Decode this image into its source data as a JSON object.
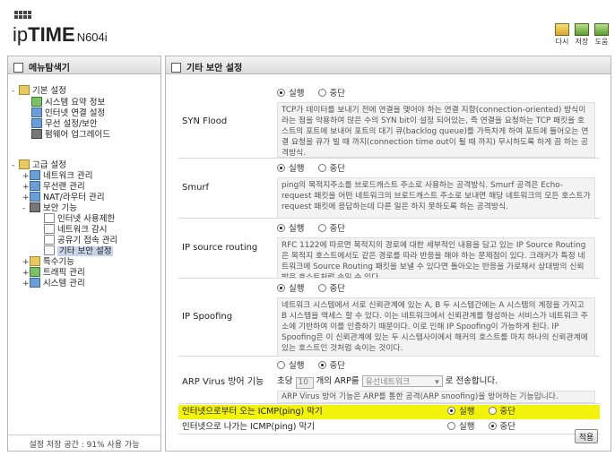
{
  "header": {
    "brand_ip": "ip",
    "brand_time": "TIME",
    "brand_model": "N604i",
    "tools": [
      {
        "label": "다시"
      },
      {
        "label": "저장"
      },
      {
        "label": "도움"
      }
    ]
  },
  "sidebar": {
    "title": "메뉴탐색기",
    "items": [
      {
        "label": "기본 설정"
      },
      {
        "label": "시스템 요약 정보"
      },
      {
        "label": "인터넷 연결 설정"
      },
      {
        "label": "무선 설정/보안"
      },
      {
        "label": "펌웨어 업그레이드"
      },
      {
        "label": "고급 설정"
      },
      {
        "label": "네트워크 관리"
      },
      {
        "label": "무선랜 관리"
      },
      {
        "label": "NAT/라우터 관리"
      },
      {
        "label": "보안 기능"
      },
      {
        "label": "인터넷 사용제한"
      },
      {
        "label": "네트워크 감시"
      },
      {
        "label": "공유기 접속 관리"
      },
      {
        "label": "기타 보안 설정"
      },
      {
        "label": "특수기능"
      },
      {
        "label": "트래픽 관리"
      },
      {
        "label": "시스템 관리"
      }
    ],
    "footer": "설정 저장 공간 : 91% 사용 가능"
  },
  "main": {
    "title": "기타 보안 설정",
    "rows": [
      {
        "label": "SYN Flood",
        "on": "실행",
        "off": "중단",
        "selected": "on",
        "desc": "TCP가 데이터를 보내기 전에 연결을 맺어야 하는 연결 지향(connection-oriented) 방식이라는 점을 악용하여 많은 수의 SYN bit이 설정 되어있는, 즉 연결을 요청하는 TCP 패킷을 호스트의 포트에 보내어 포트의 대기 큐(backlog queue)를 가득차게 하여 포트에 들어오는 연결 요청을 큐가 빌 때 까지(connection time out이 될 때 까지) 무시하도록 하게 끔 하는 공격방식."
      },
      {
        "label": "Smurf",
        "on": "실행",
        "off": "중단",
        "selected": "on",
        "desc": "ping의 목적지주소를 브로드캐스트 주소로 사용하는 공격방식. Smurf 공격은 Echo-request 패킷을 어떤 네트워크의 브로드캐스트 주소로 보내면 해당 네트워크의 모든 호스트가 request 패킷에 응답하는데 다른 일은 하지 못하도록 하는 공격방식."
      },
      {
        "label": "IP source routing",
        "on": "실행",
        "off": "중단",
        "selected": "on",
        "desc": "RFC 1122에 따르면 목적지의 경로에 대한 세부적인 내용을 담고 있는 IP Source Routing은 목적지 호스트에서도 같은 경로를 따라 반응을 해야 하는 문제점이 있다. 크래커가 특정 네트워크에 Source Routing 패킷을 보낼 수 있다면 돌아오는 반응을 가로채서 상대방의 신뢰받은 호스트처럼 속일 수 있다."
      },
      {
        "label": "IP Spoofing",
        "on": "실행",
        "off": "중단",
        "selected": "on",
        "desc": "네트워크 시스템에서 서로 신뢰관계에 있는 A, B 두 시스템간에는 A 시스템의 계정을 가지고 B 시스템을 액세스 할 수 있다. 이는 네트워크에서 신뢰관계를 형성하는 서비스가 네트워크 주소에 기반하여 이를 인증하기 때문이다. 이로 인해 IP Spoofing이 가능하게 된다. IP Spoofing은 이 신뢰관계에 있는 두 시스템사이에서 해커의 호스트를 마치 하나의 신뢰관계에 있는 호스트인 것처럼 속이는 것이다."
      }
    ],
    "arp": {
      "label": "ARP Virus 방어 기능",
      "on": "실행",
      "off": "중단",
      "selected": "off",
      "line_prefix": "초당",
      "count": "10",
      "line_mid": "개의 ARP를",
      "target": "유선네트워크",
      "line_suffix": "로 전송합니다.",
      "desc": "ARP Virus 방어 기능은 ARP를 통한 공격(ARP snoofing)을 방어하는 기능입니다."
    },
    "icmp_in": {
      "label": "인터넷으로부터 오는 ICMP(ping) 막기",
      "on": "실행",
      "off": "중단",
      "selected": "on"
    },
    "icmp_out": {
      "label": "인터넷으로 나가는 ICMP(ping) 막기",
      "on": "실행",
      "off": "중단",
      "selected": "off"
    },
    "apply_label": "적용"
  },
  "colors": {
    "highlight": "#f2f20c",
    "panel_border": "#b8b8b8"
  }
}
